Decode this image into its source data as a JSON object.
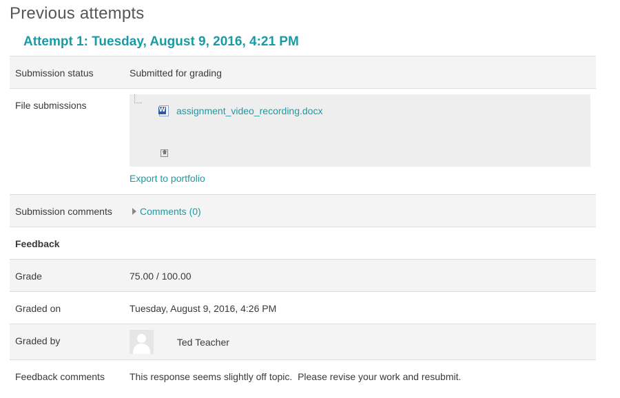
{
  "page_title": "Previous attempts",
  "attempt_title": "Attempt 1: Tuesday, August 9, 2016, 4:21 PM",
  "rows": {
    "submission_status": {
      "label": "Submission status",
      "value": "Submitted for grading"
    },
    "file_submissions": {
      "label": "File submissions",
      "file_name": "assignment_video_recording.docx",
      "file_icon": "word-doc-icon",
      "portfolio_icon": "portfolio-icon",
      "export_link": "Export to portfolio"
    },
    "submission_comments": {
      "label": "Submission comments",
      "link": "Comments (0)"
    },
    "feedback": {
      "heading": "Feedback"
    },
    "grade": {
      "label": "Grade",
      "value": "75.00 / 100.00"
    },
    "graded_on": {
      "label": "Graded on",
      "value": "Tuesday, August 9, 2016, 4:26 PM"
    },
    "graded_by": {
      "label": "Graded by",
      "name": "Ted Teacher"
    },
    "feedback_comments": {
      "label": "Feedback comments",
      "value": "This response seems slightly off topic.  Please revise your work and resubmit."
    }
  },
  "colors": {
    "link": "#1a9aa5",
    "row_alt": "#f4f4f4",
    "file_area": "#eeeeee"
  }
}
